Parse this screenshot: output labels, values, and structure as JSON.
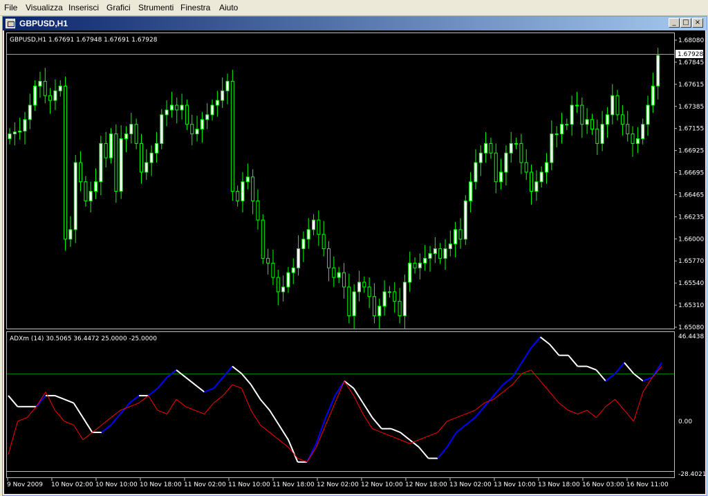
{
  "menu": [
    "File",
    "Visualizza",
    "Inserisci",
    "Grafici",
    "Strumenti",
    "Finestra",
    "Aiuto"
  ],
  "window": {
    "title": "GBPUSD,H1",
    "min": "_",
    "max": "□",
    "close": "×"
  },
  "price_chart": {
    "info": "GBPUSD,H1  1.67691 1.67948 1.67691 1.67928",
    "current_price": "1.67928",
    "ticks": [
      "1.68080",
      "1.67845",
      "1.67615",
      "1.67385",
      "1.67155",
      "1.66925",
      "1.66695",
      "1.66465",
      "1.66235",
      "1.66000",
      "1.65770",
      "1.65540",
      "1.65310",
      "1.65080"
    ]
  },
  "indicator": {
    "info": "ADXm (14) 30.5065 36.4472 25.0000 -25.0000",
    "ticks": [
      "46.4438",
      "0.00",
      "-28.4021"
    ]
  },
  "time_axis": [
    "9 Nov 2009",
    "10 Nov 02:00",
    "10 Nov 10:00",
    "10 Nov 18:00",
    "11 Nov 02:00",
    "11 Nov 10:00",
    "11 Nov 18:00",
    "12 Nov 02:00",
    "12 Nov 10:00",
    "12 Nov 18:00",
    "13 Nov 02:00",
    "13 Nov 10:00",
    "13 Nov 18:00",
    "16 Nov 03:00",
    "16 Nov 11:00"
  ],
  "colors": {
    "bull": "#ffffff",
    "bear": "#000000",
    "wick": "#00ff00",
    "adx_up": "#0000ff",
    "adx_down": "#ffffff",
    "red": "#ff0000",
    "level": "#008000"
  },
  "chart_data": {
    "type": "candlestick",
    "close_series": [
      1.671,
      1.6712,
      1.6713,
      1.6725,
      1.674,
      1.676,
      1.6765,
      1.675,
      1.6745,
      1.6755,
      1.676,
      1.66,
      1.661,
      1.668,
      1.666,
      1.664,
      1.665,
      1.666,
      1.67,
      1.6685,
      1.671,
      1.665,
      1.6705,
      1.671,
      1.672,
      1.67,
      1.667,
      1.668,
      1.669,
      1.67,
      1.673,
      1.6735,
      1.674,
      1.6735,
      1.674,
      1.672,
      1.671,
      1.6715,
      1.6725,
      1.673,
      1.674,
      1.6745,
      1.6755,
      1.6765,
      1.665,
      1.664,
      1.666,
      1.6665,
      1.664,
      1.662,
      1.658,
      1.6575,
      1.656,
      1.6545,
      1.655,
      1.6565,
      1.657,
      1.659,
      1.66,
      1.661,
      1.662,
      1.6605,
      1.659,
      1.657,
      1.656,
      1.6565,
      1.655,
      1.652,
      1.6545,
      1.6555,
      1.655,
      1.654,
      1.652,
      1.653,
      1.6545,
      1.6545,
      1.6535,
      1.652,
      1.6555,
      1.6575,
      1.657,
      1.6575,
      1.658,
      1.6585,
      1.659,
      1.658,
      1.659,
      1.6595,
      1.661,
      1.66,
      1.664,
      1.666,
      1.668,
      1.669,
      1.67,
      1.669,
      1.666,
      1.667,
      1.669,
      1.67,
      1.67,
      1.668,
      1.667,
      1.665,
      1.666,
      1.667,
      1.668,
      1.671,
      1.671,
      1.672,
      1.672,
      1.674,
      1.674,
      1.672,
      1.6725,
      1.6715,
      1.67,
      1.672,
      1.673,
      1.675,
      1.673,
      1.672,
      1.671,
      1.67,
      1.6705,
      1.672,
      1.674,
      1.676,
      1.6792
    ],
    "ylim": [
      1.6508,
      1.6808
    ]
  }
}
